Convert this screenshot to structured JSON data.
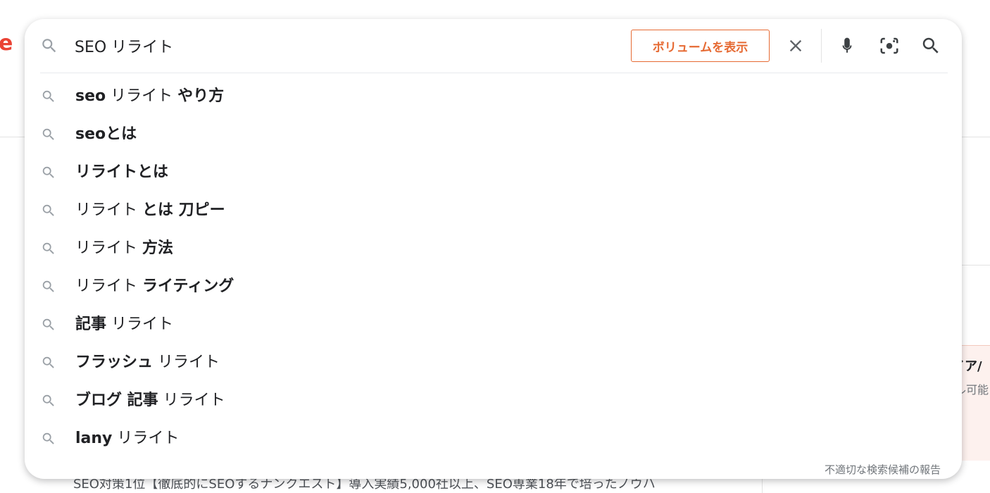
{
  "search": {
    "query": "SEO リライト",
    "volume_button_label": "ボリュームを表示",
    "icons": {
      "left": "search-icon",
      "clear": "close-icon",
      "voice": "microphone-icon",
      "lens": "camera-lens-icon",
      "submit": "search-icon"
    }
  },
  "suggestions": [
    {
      "parts": [
        {
          "t": "seo",
          "b": true
        },
        {
          "t": " リライト ",
          "b": false
        },
        {
          "t": "やり方",
          "b": true
        }
      ]
    },
    {
      "parts": [
        {
          "t": "seoとは",
          "b": true
        }
      ]
    },
    {
      "parts": [
        {
          "t": "リライトとは",
          "b": true
        }
      ]
    },
    {
      "parts": [
        {
          "t": "リライト ",
          "b": false
        },
        {
          "t": "とは 刀ピー",
          "b": true
        }
      ]
    },
    {
      "parts": [
        {
          "t": "リライト ",
          "b": false
        },
        {
          "t": "方法",
          "b": true
        }
      ]
    },
    {
      "parts": [
        {
          "t": "リライト ",
          "b": false
        },
        {
          "t": "ライティング",
          "b": true
        }
      ]
    },
    {
      "parts": [
        {
          "t": "記事",
          "b": true
        },
        {
          "t": " リライト",
          "b": false
        }
      ]
    },
    {
      "parts": [
        {
          "t": "フラッシュ",
          "b": true
        },
        {
          "t": " リライト",
          "b": false
        }
      ]
    },
    {
      "parts": [
        {
          "t": "ブログ 記事",
          "b": true
        },
        {
          "t": " リライト",
          "b": false
        }
      ]
    },
    {
      "parts": [
        {
          "t": "lany",
          "b": true
        },
        {
          "t": " リライト",
          "b": false
        }
      ]
    }
  ],
  "report_link_label": "不適切な検索候補の報告",
  "background": {
    "logo_fragment": "e",
    "ad_title_fragment": "イア/",
    "ad_sub_fragment": "ル可能",
    "snippet": "SEO対策1位【徹底的にSEOするナンクエスト】導入実績5,000社以上、SEO専業18年で培ったノウハ"
  },
  "colors": {
    "accent_orange": "#e66a33",
    "text": "#202124",
    "muted": "#70757a",
    "icon_gray": "#9aa0a6",
    "google_red": "#ea4335"
  }
}
